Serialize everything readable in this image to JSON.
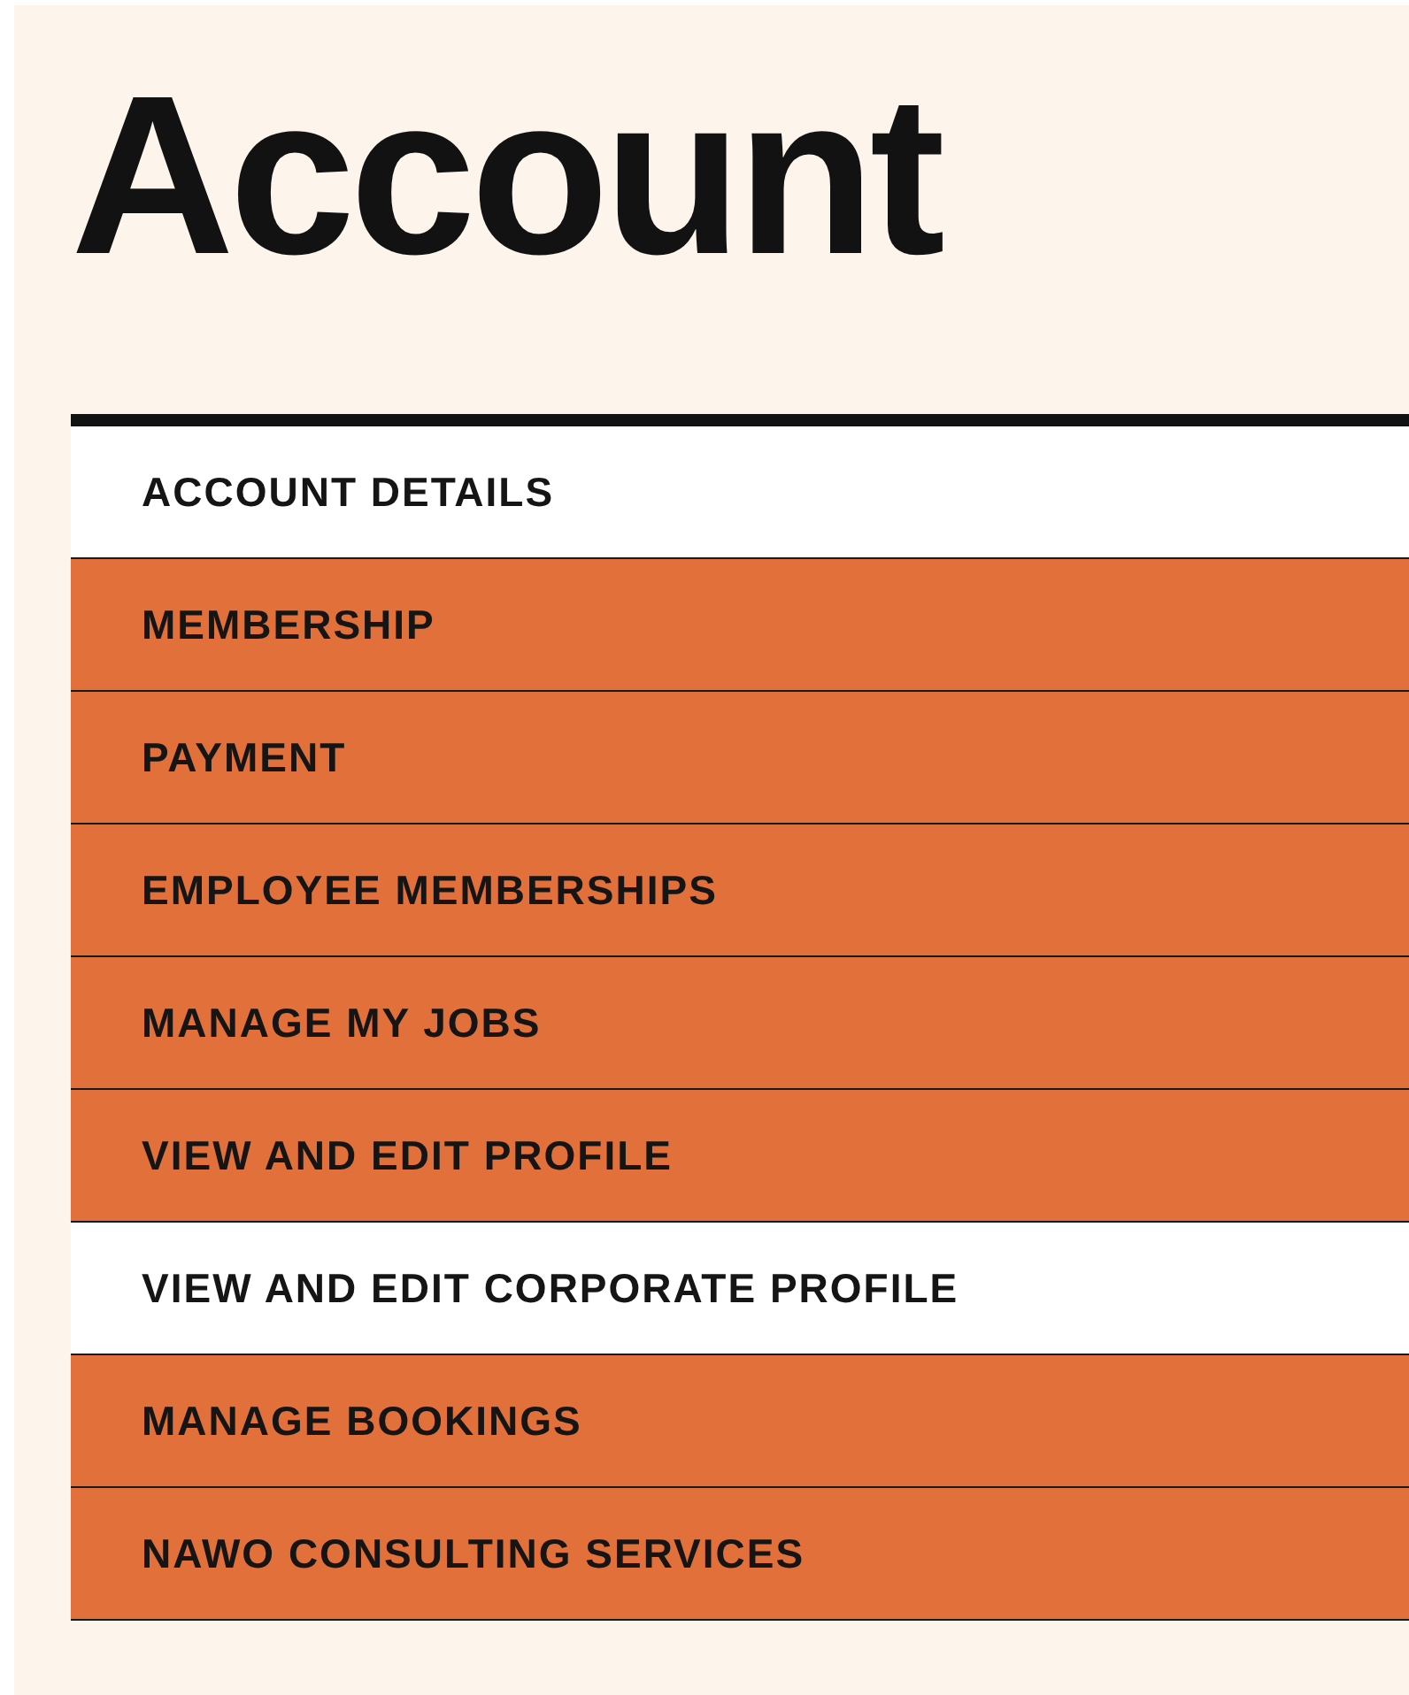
{
  "title": "Account",
  "menu": [
    {
      "label": "ACCOUNT DETAILS",
      "selected": true
    },
    {
      "label": "MEMBERSHIP",
      "selected": false
    },
    {
      "label": "PAYMENT",
      "selected": false
    },
    {
      "label": "EMPLOYEE MEMBERSHIPS",
      "selected": false
    },
    {
      "label": "MANAGE MY JOBS",
      "selected": false
    },
    {
      "label": "VIEW AND EDIT PROFILE",
      "selected": false
    },
    {
      "label": "VIEW AND EDIT CORPORATE PROFILE",
      "selected": true
    },
    {
      "label": "MANAGE BOOKINGS",
      "selected": false
    },
    {
      "label": "NAWO CONSULTING SERVICES",
      "selected": false
    }
  ]
}
